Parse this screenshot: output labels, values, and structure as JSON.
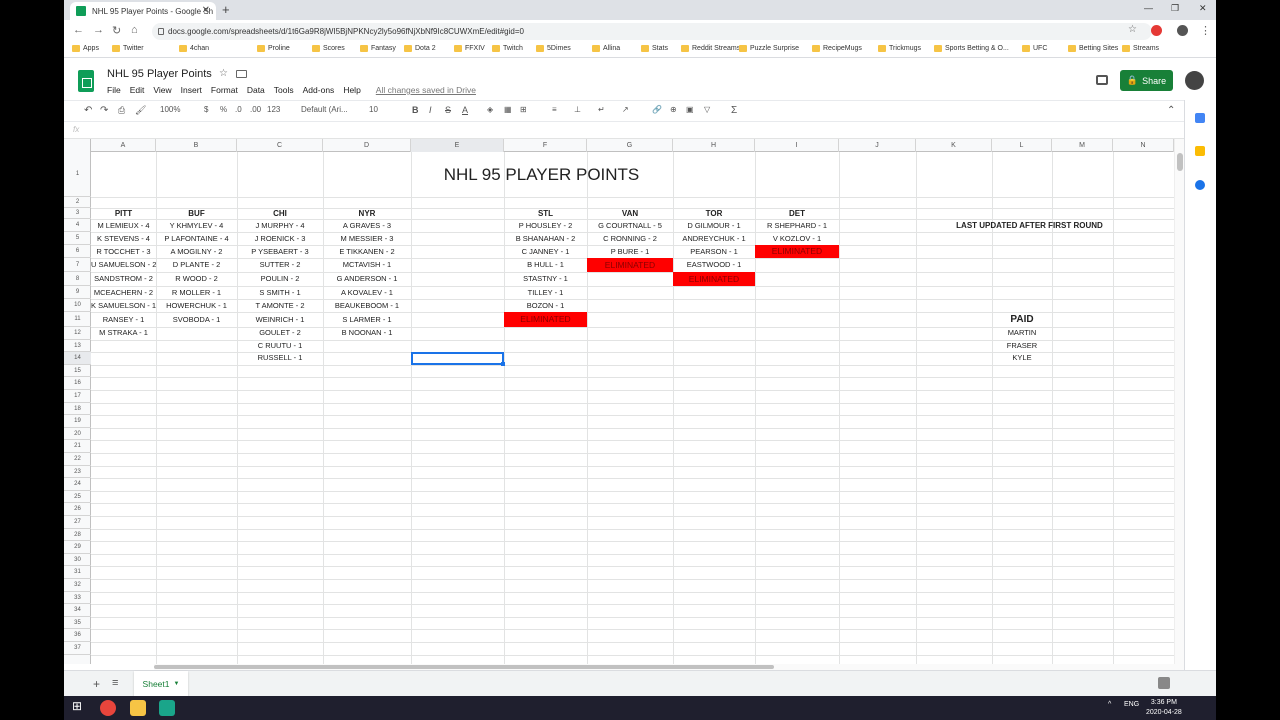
{
  "browser": {
    "tab_title": "NHL 95 Player Points - Google Sh",
    "url": "docs.google.com/spreadsheets/d/1t6Ga9R8jWI5BjNPKNcy2ly5o96fNjXbNf9Ic8CUWXmE/edit#gid=0",
    "bookmarks": [
      "Apps",
      "Twitter",
      "4chan",
      "Proline",
      "Scores",
      "Fantasy",
      "Dota 2",
      "FFXIV",
      "Twitch",
      "5Dimes",
      "Allina",
      "Stats",
      "Reddit Streams",
      "Puzzle Surprise",
      "RecipeMugs",
      "Trickmugs",
      "Sports Betting & O...",
      "UFC",
      "Betting Sites",
      "Streams"
    ]
  },
  "sheets": {
    "doc_title": "NHL 95 Player Points",
    "menu": [
      "File",
      "Edit",
      "View",
      "Insert",
      "Format",
      "Data",
      "Tools",
      "Add-ons",
      "Help"
    ],
    "saved_status": "All changes saved in Drive",
    "share_label": "Share",
    "toolbar": {
      "zoom": "100%",
      "currency": "$",
      "percent": "%",
      "dec_less": ".0",
      "dec_more": ".00",
      "format_more": "123",
      "font": "Default (Ari...",
      "font_size": "10",
      "bold": "B",
      "italic": "I",
      "strike": "S",
      "text_color": "A",
      "sum": "Σ"
    },
    "fx": "fx",
    "sheet_tab": "Sheet1"
  },
  "columns": [
    "A",
    "B",
    "C",
    "D",
    "E",
    "F",
    "G",
    "H",
    "I",
    "J",
    "K",
    "L",
    "M",
    "N"
  ],
  "rows": [
    "1",
    "2",
    "3",
    "4",
    "5",
    "6",
    "7",
    "8",
    "9",
    "10",
    "11",
    "12",
    "13",
    "14",
    "15",
    "16",
    "17",
    "18",
    "19",
    "20",
    "21",
    "22",
    "23",
    "24",
    "25",
    "26",
    "27",
    "28",
    "29",
    "30",
    "31",
    "32",
    "33",
    "34",
    "35",
    "36",
    "37"
  ],
  "title": "NHL 95 PLAYER POINTS",
  "teams": [
    {
      "name": "PITT",
      "players": [
        "M LEMIEUX - 4",
        "K STEVENS - 4",
        "R TOCCHET - 3",
        "U SAMUELSON - 2",
        "SANDSTROM - 2",
        "MCEACHERN - 2",
        "K SAMUELSON - 1",
        "RANSEY - 1",
        "M STRAKA - 1"
      ]
    },
    {
      "name": "BUF",
      "players": [
        "Y KHMYLEV - 4",
        "P LAFONTAINE - 4",
        "A MOGILNY - 2",
        "D PLANTE - 2",
        "R WOOD - 2",
        "R MOLLER - 1",
        "HOWERCHUK - 1",
        "SVOBODA - 1"
      ]
    },
    {
      "name": "CHI",
      "players": [
        "J MURPHY - 4",
        "J ROENICK - 3",
        "P YSEBAERT - 3",
        "SUTTER - 2",
        "POULIN - 2",
        "S SMITH - 1",
        "T AMONTE - 2",
        "WEINRICH - 1",
        "GOULET - 2",
        "C RUUTU - 1",
        "RUSSELL - 1"
      ]
    },
    {
      "name": "NYR",
      "players": [
        "A GRAVES - 3",
        "M MESSIER - 3",
        "E TIKKANEN - 2",
        "MCTAVISH - 1",
        "G ANDERSON - 1",
        "A KOVALEV - 1",
        "BEAUKEBOOM - 1",
        "S LARMER - 1",
        "B NOONAN - 1"
      ]
    },
    {
      "name": "STL",
      "players": [
        "P HOUSLEY - 2",
        "B SHANAHAN - 2",
        "C JANNEY - 1",
        "B HULL - 1",
        "STASTNY - 1",
        "TILLEY - 1",
        "BOZON - 1"
      ],
      "eliminated_row": 11
    },
    {
      "name": "VAN",
      "players": [
        "G COURTNALL - 5",
        "C RONNING - 2",
        "P BURE - 1"
      ],
      "eliminated_row": 7
    },
    {
      "name": "TOR",
      "players": [
        "D GILMOUR - 1",
        "ANDREYCHUK - 1",
        "PEARSON - 1",
        "EASTWOOD - 1"
      ],
      "eliminated_row": 8
    },
    {
      "name": "DET",
      "players": [
        "R SHEPHARD - 1",
        "V KOZLOV - 1"
      ],
      "eliminated_row": 6
    }
  ],
  "eliminated_label": "ELIMINATED",
  "last_updated": "LAST UPDATED AFTER  FIRST ROUND",
  "paid": {
    "header": "PAID",
    "names": [
      "MARTIN",
      "FRASER",
      "KYLE"
    ]
  },
  "taskbar": {
    "lang": "ENG",
    "time": "3:36 PM",
    "date": "2020-04-28"
  },
  "colors": {
    "eliminated": "#ff0000",
    "share": "#188038",
    "selection": "#1a73e8"
  }
}
